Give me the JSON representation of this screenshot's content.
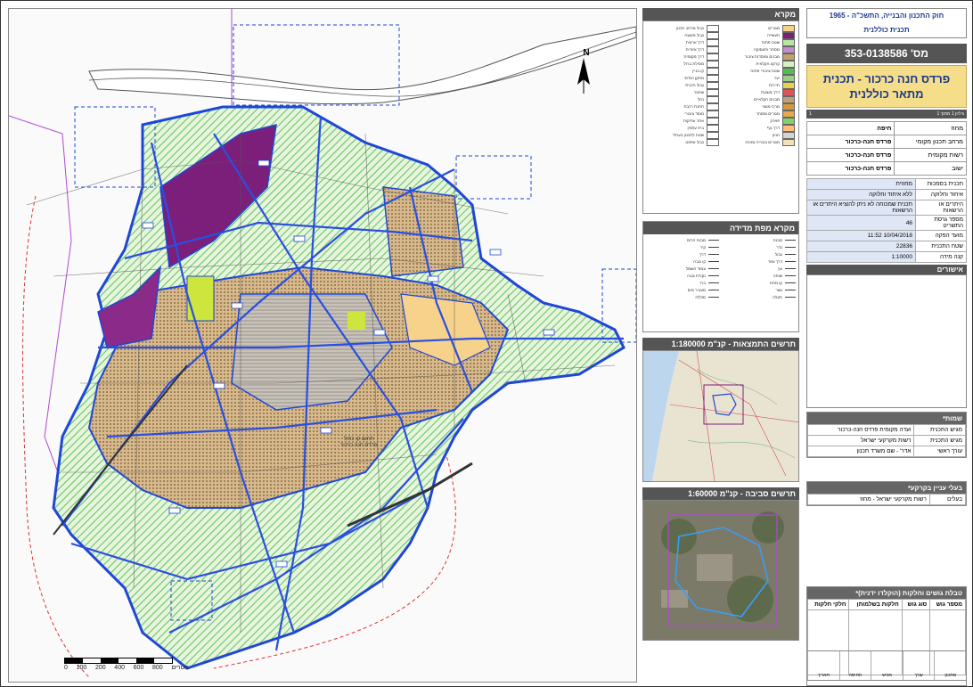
{
  "map": {
    "scale_labels": [
      "0",
      "100",
      "200",
      "400",
      "600",
      "800"
    ],
    "scale_unit": "מטרים",
    "north": "N",
    "note_lines": [
      "תחום קו כחול",
      "פרדס חנה כרכור"
    ]
  },
  "legend": {
    "title": "מקרא",
    "items": [
      {
        "label": "מגורים",
        "color": "#f6d28a"
      },
      {
        "label": "גבול מרחב תכנון",
        "color": "#ffffff"
      },
      {
        "label": "תעשייה",
        "color": "#7b1f7a"
      },
      {
        "label": "גבול מועצה",
        "color": "#ffffff"
      },
      {
        "label": "שטח פתוח",
        "color": "#b6e6a0"
      },
      {
        "label": "דרך ארצית",
        "color": "#ffffff"
      },
      {
        "label": "מסחר ותעסוקה",
        "color": "#c58ccc"
      },
      {
        "label": "דרך אזורית",
        "color": "#ffffff"
      },
      {
        "label": "מבנים ומוסדות ציבור",
        "color": "#c4a26a"
      },
      {
        "label": "דרך מקומית",
        "color": "#ffffff"
      },
      {
        "label": "קרקע חקלאית",
        "color": "#d7f0c2"
      },
      {
        "label": "מסילת ברזל",
        "color": "#ffffff"
      },
      {
        "label": "שטח ציבורי פתוח",
        "color": "#4fbf4f"
      },
      {
        "label": "קו בניין",
        "color": "#ffffff"
      },
      {
        "label": "יער",
        "color": "#9ccc8a"
      },
      {
        "label": "מתקן הנדסי",
        "color": "#ffffff"
      },
      {
        "label": "תיירות",
        "color": "#e7d24a"
      },
      {
        "label": "גבול תכנית",
        "color": "#ffffff"
      },
      {
        "label": "דרך מוצעת",
        "color": "#e0535a"
      },
      {
        "label": "שימור",
        "color": "#ffffff"
      },
      {
        "label": "מבנים חקלאיים",
        "color": "#bfa07d"
      },
      {
        "label": "נחל",
        "color": "#ffffff"
      },
      {
        "label": "מרכז משני",
        "color": "#d49a3a"
      },
      {
        "label": "תחנת רכבת",
        "color": "#ffffff"
      },
      {
        "label": "מגורים ומסחר",
        "color": "#e8a94e"
      },
      {
        "label": "מוסד ציבורי",
        "color": "#ffffff"
      },
      {
        "label": "פארק",
        "color": "#7fd36a"
      },
      {
        "label": "אתר עתיקות",
        "color": "#ffffff"
      },
      {
        "label": "דרך נוף",
        "color": "#ffbe7a"
      },
      {
        "label": "בית עלמין",
        "color": "#ffffff"
      },
      {
        "label": "חניון",
        "color": "#d3d3d3"
      },
      {
        "label": "שטח לתכנון בעתיד",
        "color": "#ffffff"
      },
      {
        "label": "מגורים בבנייה נמוכה",
        "color": "#f0e2b6"
      },
      {
        "label": "גבול שיפוט",
        "color": "#ffffff"
      }
    ]
  },
  "legend2": {
    "title": "מקרא מפת מדידה",
    "lines": [
      "מבנה",
      "מבנה הרוס",
      "גדר",
      "קיר",
      "גבול",
      "דרך",
      "דרך עפר",
      "קו גובה",
      "עץ",
      "עמוד חשמל",
      "שוחה",
      "נקודת גובה",
      "קו מתח",
      "ברז",
      "גשר",
      "מעביר מים",
      "תעלה",
      "סוללה"
    ]
  },
  "inset1": {
    "title": "תרשים התמצאות - קנ\"מ 1:180000"
  },
  "inset2": {
    "title": "תרשים סביבה - קנ\"מ 1:60000"
  },
  "right": {
    "law_line1": "חוק התכנון והבנייה, התשכ\"ה - 1965",
    "law_line2": "תכנית כוללנית",
    "plan_number": "מס' 353-0138586",
    "plan_title": "פרדס חנה כרכור - תכנית מתאר כוללנית",
    "sheet_label": "גיליון 1 מתוך 1",
    "sheet_left": "1",
    "info": [
      {
        "k": "מחוז",
        "v": "חיפה"
      },
      {
        "k": "מרחב תכנון מקומי",
        "v": "פרדס חנה-כרכור"
      },
      {
        "k": "רשות מקומית",
        "v": "פרדס חנה-כרכור"
      },
      {
        "k": "ישוב",
        "v": "פרדס חנה-כרכור"
      }
    ],
    "status": [
      {
        "k": "תכנית בסמכות",
        "v": "מחוזית"
      },
      {
        "k": "איחוד וחלוקה",
        "v": "ללא איחוד וחלוקה"
      },
      {
        "k": "היתרים או הרשאות",
        "v": "תכנית שמכוחה לא ניתן להוציא היתרים או הרשאות"
      },
      {
        "k": "מספר גרסת התשריט",
        "v": "46"
      },
      {
        "k": "מועד הפקה",
        "v": "10/04/2018  11:52"
      },
      {
        "k": "שטח התכנית",
        "v": "22836"
      },
      {
        "k": "קנה מידה",
        "v": "1:10000"
      }
    ],
    "approvals": "אישורים",
    "signatures_title": "שמות*",
    "signatures": [
      {
        "k": "מגיש התכנית",
        "v": "ועדה מקומית פרדס חנה-כרכור"
      },
      {
        "k": "מגיש התכנית",
        "v": "רשות מקרקעי ישראל"
      },
      {
        "k": "עורך ראשי",
        "v": "אדר' - שם משרד תכנון"
      }
    ],
    "owners_title": "בעלי עניין בקרקע*",
    "owners": [
      {
        "k": "בעלים",
        "v": "רשות מקרקעי ישראל - מחוז"
      }
    ],
    "parcels_title": "טבלת גושים וחלקות (הוקלדו ידנית)*",
    "parcels_cols": [
      "מספר גוש",
      "סוג גוש",
      "חלקות בשלמותן",
      "חלקי חלקות"
    ],
    "footer": [
      "מתכנן",
      "עורך",
      "מגיש",
      "חתימה",
      "תאריך"
    ]
  }
}
